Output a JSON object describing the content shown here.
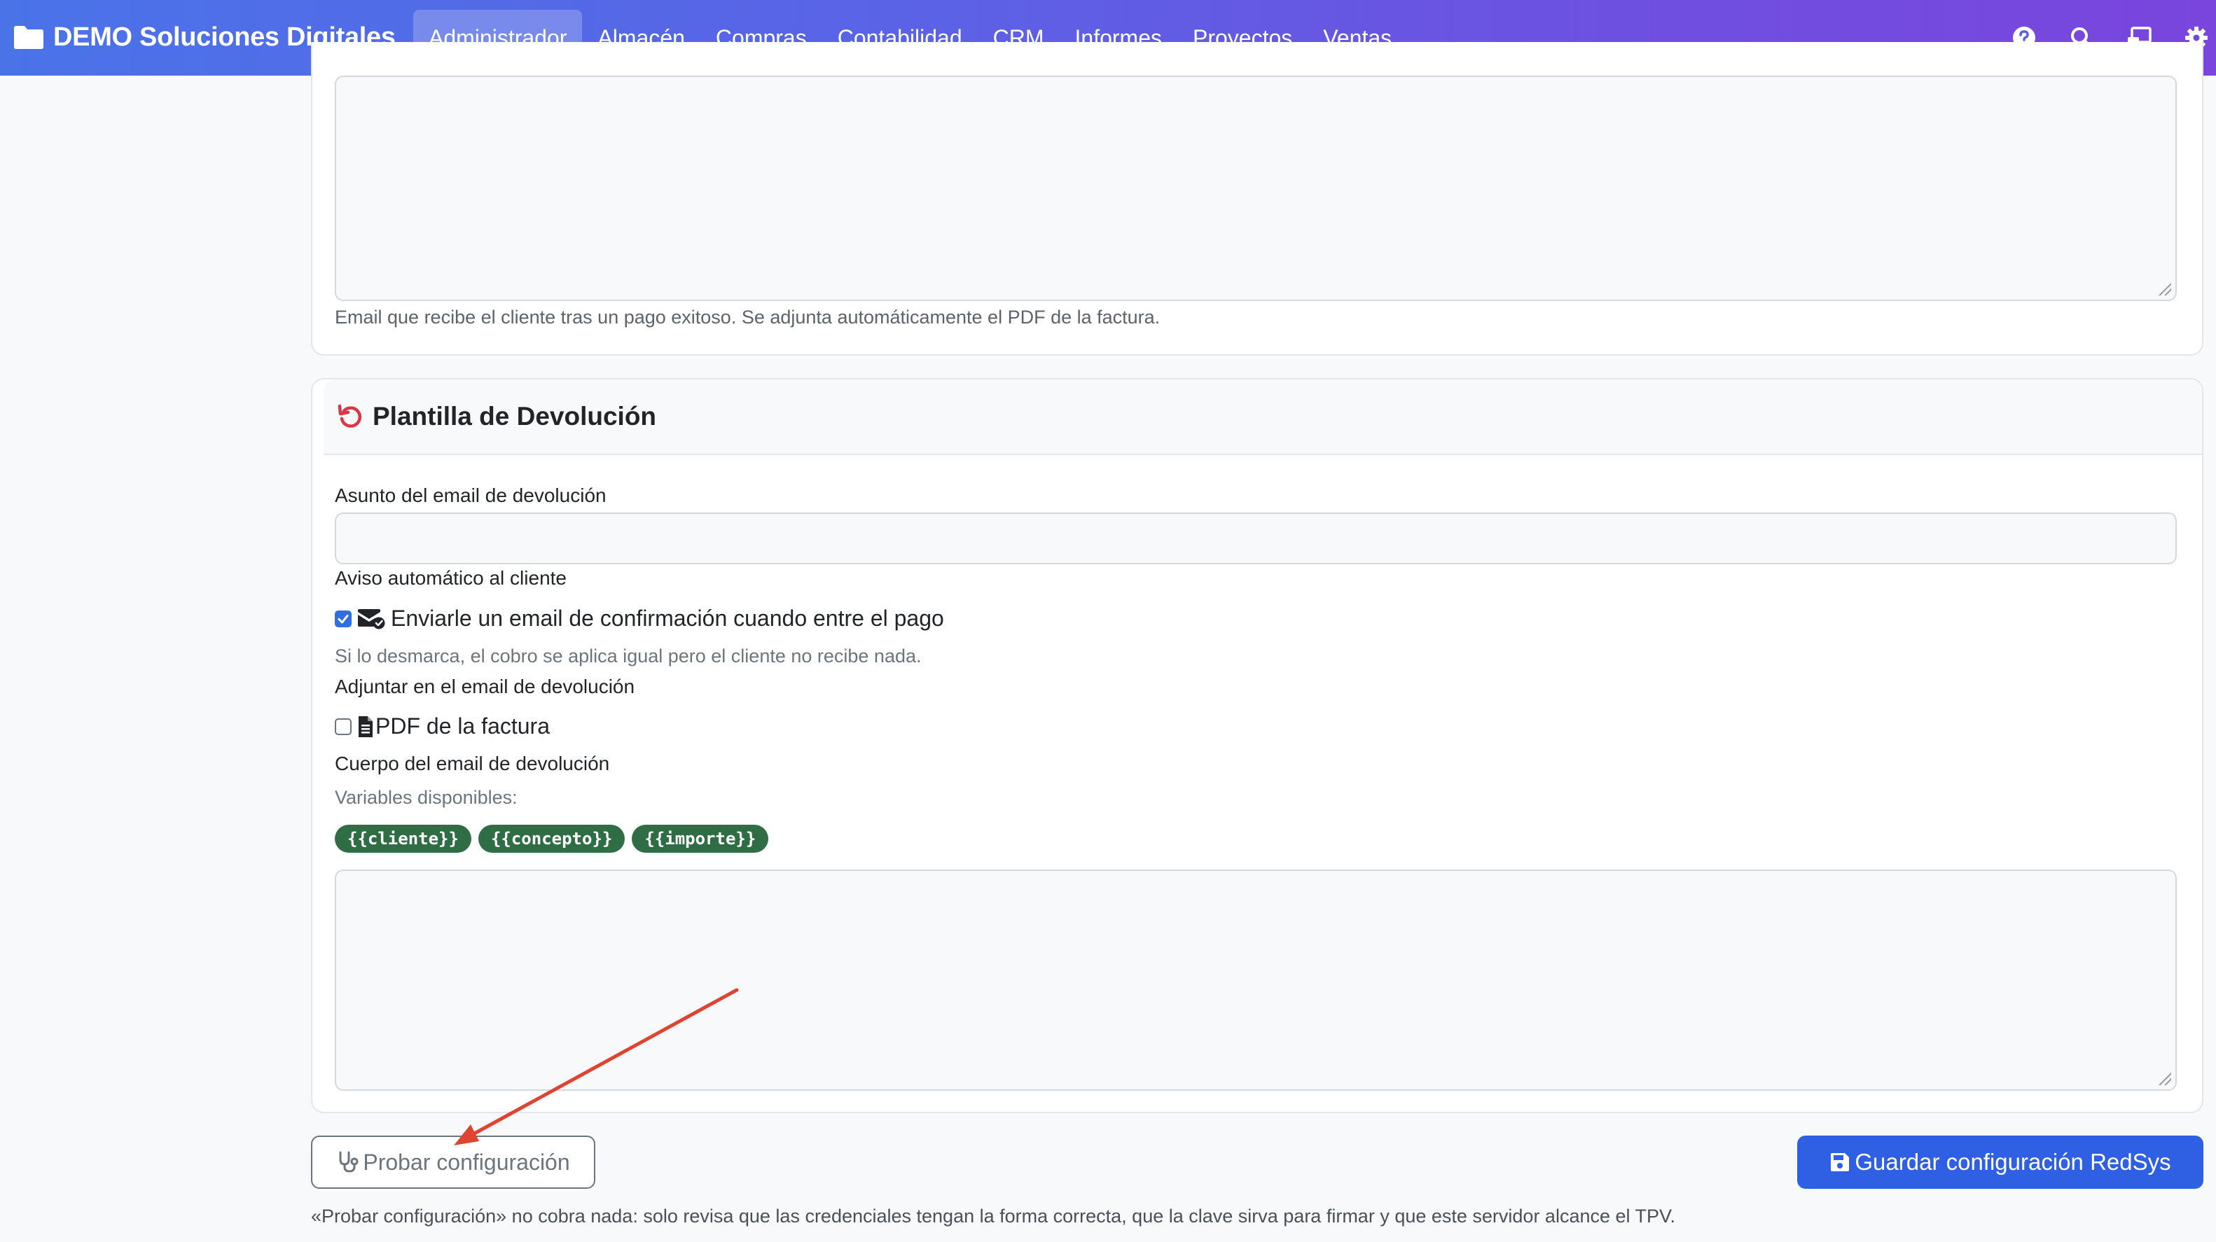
{
  "navbar": {
    "brand": "DEMO Soluciones Digitales",
    "items": [
      {
        "label": "Administrador",
        "active": true
      },
      {
        "label": "Almacén"
      },
      {
        "label": "Compras"
      },
      {
        "label": "Contabilidad"
      },
      {
        "label": "CRM"
      },
      {
        "label": "Informes"
      },
      {
        "label": "Proyectos"
      },
      {
        "label": "Ventas"
      }
    ],
    "icons": [
      "help-icon",
      "search-icon",
      "remote-desktop-icon",
      "gear-icon"
    ],
    "gradient": [
      "#4a73e8",
      "#7a45dd"
    ]
  },
  "confirm_card": {
    "body_help": "Email que recibe el cliente tras un pago exitoso. Se adjunta automáticamente el PDF de la factura."
  },
  "refund_card": {
    "title": "Plantilla de Devolución",
    "title_icon": "undo-icon",
    "subject_label": "Asunto del email de devolución",
    "subject_value": "",
    "notice_label": "Aviso automático al cliente",
    "notify_checkbox_label": "Enviarle un email de confirmación cuando entre el pago",
    "notify_checked": true,
    "notify_help": "Si lo desmarca, el cobro se aplica igual pero el cliente no recibe nada.",
    "attach_label": "Adjuntar en el email de devolución",
    "pdf_checkbox_label": "PDF de la factura",
    "pdf_checked": false,
    "body_label": "Cuerpo del email de devolución",
    "variables_label": "Variables disponibles:",
    "variables": [
      "{{cliente}}",
      "{{concepto}}",
      "{{importe}}"
    ],
    "body_value": ""
  },
  "actions": {
    "test_label": "Probar configuración",
    "save_label": "Guardar configuración RedSys",
    "footnote": "«Probar configuración» no cobra nada: solo revisa que las credenciales tengan la forma correcta, que la clave sirva para firmar y que este servidor alcance el TPV."
  },
  "colors": {
    "primary": "#2f5fe3",
    "chip": "#2f6e44",
    "undo_icon": "#dc3545",
    "annotation_arrow": "#e0432f"
  }
}
